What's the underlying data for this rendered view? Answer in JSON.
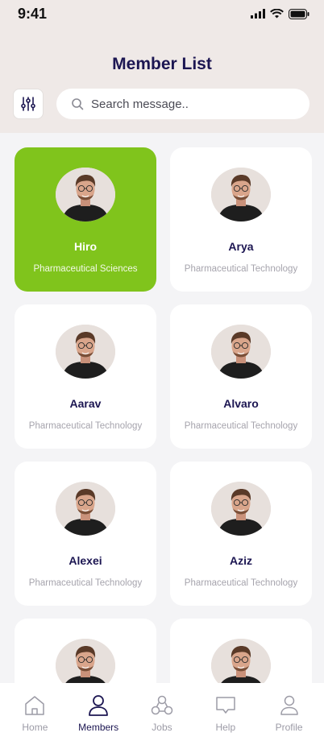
{
  "status": {
    "time": "9:41"
  },
  "header": {
    "title": "Member List"
  },
  "search": {
    "placeholder": "Search message.."
  },
  "members": [
    {
      "name": "Hiro",
      "dept": "Pharmaceutical Sciences",
      "active": true
    },
    {
      "name": "Arya",
      "dept": "Pharmaceutical Technology",
      "active": false
    },
    {
      "name": "Aarav",
      "dept": "Pharmaceutical Technology",
      "active": false
    },
    {
      "name": "Alvaro",
      "dept": "Pharmaceutical Technology",
      "active": false
    },
    {
      "name": "Alexei",
      "dept": "Pharmaceutical Technology",
      "active": false
    },
    {
      "name": "Aziz",
      "dept": "Pharmaceutical Technology",
      "active": false
    },
    {
      "name": "",
      "dept": "",
      "active": false
    },
    {
      "name": "",
      "dept": "",
      "active": false
    }
  ],
  "nav": [
    {
      "label": "Home",
      "icon": "home-icon",
      "active": false
    },
    {
      "label": "Members",
      "icon": "members-icon",
      "active": true
    },
    {
      "label": "Jobs",
      "icon": "jobs-icon",
      "active": false
    },
    {
      "label": "Help",
      "icon": "help-icon",
      "active": false
    },
    {
      "label": "Profile",
      "icon": "profile-icon",
      "active": false
    }
  ],
  "colors": {
    "accent": "#80c41c",
    "title": "#1c1652",
    "header_bg": "#efe9e7"
  }
}
